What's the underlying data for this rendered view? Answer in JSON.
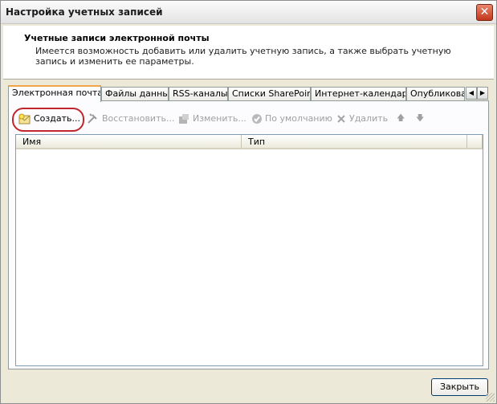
{
  "window": {
    "title": "Настройка учетных записей",
    "close_glyph": "✕"
  },
  "header": {
    "title": "Учетные записи электронной почты",
    "description": "Имеется возможность добавить или удалить учетную запись, а также выбрать учетную запись и изменить ее параметры."
  },
  "tabs": [
    {
      "label": "Электронная почта",
      "active": true
    },
    {
      "label": "Файлы данных",
      "active": false
    },
    {
      "label": "RSS-каналы",
      "active": false
    },
    {
      "label": "Списки SharePoint",
      "active": false
    },
    {
      "label": "Интернет-календари",
      "active": false
    },
    {
      "label": "Опубликованные календари",
      "active": false
    }
  ],
  "tab_scroll": {
    "left": "◀",
    "right": "▶"
  },
  "toolbar": {
    "new_label": "Создать...",
    "repair_label": "Восстановить...",
    "change_label": "Изменить...",
    "default_label": "По умолчанию",
    "remove_label": "Удалить",
    "up_glyph": "🡅",
    "down_glyph": "🡇"
  },
  "list": {
    "columns": [
      "Имя",
      "Тип"
    ],
    "rows": []
  },
  "footer": {
    "close_label": "Закрыть"
  },
  "colors": {
    "highlight_ring": "#c0262b",
    "active_tab_accent": "#f0a54a"
  }
}
